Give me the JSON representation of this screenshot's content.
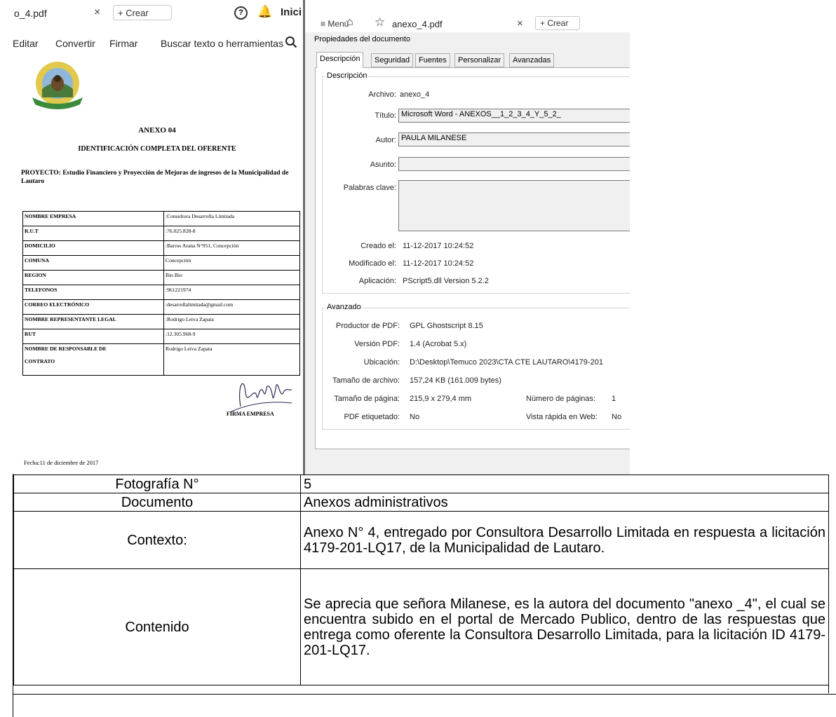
{
  "left_viewer": {
    "tab_title": "o_4.pdf",
    "tab_close": "×",
    "crear_label": "+ Crear",
    "help_glyph": "?",
    "bell_glyph": "🔔",
    "user_label": "Inici",
    "toolbar": [
      "Editar",
      "Convertir",
      "Firmar",
      "Buscar texto o herramientas"
    ]
  },
  "document": {
    "logo_text": "MUNICIPALIDAD DE LAUTARO · MAS CERCA DE LA GENTE",
    "anexo_title": "ANEXO 04",
    "identificacion": "IDENTIFICACIÓN COMPLETA DEL OFERENTE",
    "proyecto": "PROYECTO: Estudio Financiero y Proyección de Mejoras de ingresos de la Municipalidad de Lautaro",
    "rows": [
      {
        "k": "NOMBRE  EMPRESA",
        "v": ":Consultora Desarrolla Limitada"
      },
      {
        "k": "R.U.T",
        "v": ":76.025.828-8"
      },
      {
        "k": "DOMICILIO",
        "v": ":Barros Arana N°951, Concepción"
      },
      {
        "k": "COMUNA",
        "v": "Concepción"
      },
      {
        "k": "REGION",
        "v": "Bio Bio"
      },
      {
        "k": "TELEFONOS",
        "v": ":961221974"
      },
      {
        "k": "CORREO ELECTRÓNICO",
        "v": ":desarrollalimitada@gmail.com"
      },
      {
        "k": "NOMBRE REPRESENTANTE LEGAL",
        "v": ":Rodrigo Leiva Zapata"
      },
      {
        "k": "RUT",
        "v": ":12.305.968-9"
      },
      {
        "k": "NOMBRE DE RESPONSABLE DE\n\nCONTRATO",
        "v": "Rodrigo Leiva Zapata"
      }
    ],
    "firma": "FIRMA EMPRESA",
    "fecha": "Fecha:11 de diciembre de 2017"
  },
  "right_viewer": {
    "menu_label": "≡ Menú",
    "tab_title": "anexo_4.pdf",
    "tab_close": "×",
    "crear_label": "+ Crear",
    "dialog_title": "Propiedades del documento",
    "tabs": [
      "Descripción",
      "Seguridad",
      "Fuentes",
      "Personalizar",
      "Avanzadas"
    ],
    "descripcion_group": "Descripción",
    "archivo_label": "Archivo:",
    "archivo": "anexo_4",
    "titulo_label": "Título:",
    "titulo": "Microsoft Word - ANEXOS__1_2_3_4_Y_5_2_",
    "autor_label": "Autor:",
    "autor": "PAULA MILANESE",
    "asunto_label": "Asunto:",
    "asunto": "",
    "palabras_label": "Palabras clave:",
    "palabras": "",
    "creado_label": "Creado el:",
    "creado": "11-12-2017 10:24:52",
    "modificado_label": "Modificado el:",
    "modificado": "11-12-2017 10:24:52",
    "aplicacion_label": "Aplicación:",
    "aplicacion": "PScript5.dll Version 5.2.2",
    "avanzado_group": "Avanzado",
    "productor_label": "Productor de PDF:",
    "productor": "GPL Ghostscript 8.15",
    "version_label": "Versión PDF:",
    "version": "1.4 (Acrobat 5.x)",
    "ubicacion_label": "Ubicación:",
    "ubicacion": "D:\\Desktop\\Temuco 2023\\CTA CTE LAUTARO\\4179-201",
    "tamano_archivo_label": "Tamaño de archivo:",
    "tamano_archivo": "157,24 KB (161.009 bytes)",
    "tamano_pagina_label": "Tamaño de página:",
    "tamano_pagina": "215,9 x 279,4 mm",
    "num_paginas_label": "Número de páginas:",
    "num_paginas": "1",
    "etiquetado_label": "PDF etiquetado:",
    "etiquetado": "No",
    "vista_rapida_label": "Vista rápida en Web:",
    "vista_rapida": "No"
  },
  "info_table": [
    {
      "label": "Fotografía N°",
      "value": "5"
    },
    {
      "label": "Documento",
      "value": "Anexos administrativos"
    },
    {
      "label": "Contexto:",
      "value": "Anexo N° 4, entregado por Consultora Desarrollo Limitada en respuesta a licitación 4179-201-LQ17, de la Municipalidad de Lautaro."
    },
    {
      "label": "Contenido",
      "value": "Se aprecia que señora Milanese, es la autora del documento \"anexo _4\", el cual se encuentra subido en el portal de Mercado Publico, dentro de las respuestas que entrega como oferente la Consultora Desarrollo Limitada, para la licitación ID 4179-201-LQ17."
    }
  ]
}
